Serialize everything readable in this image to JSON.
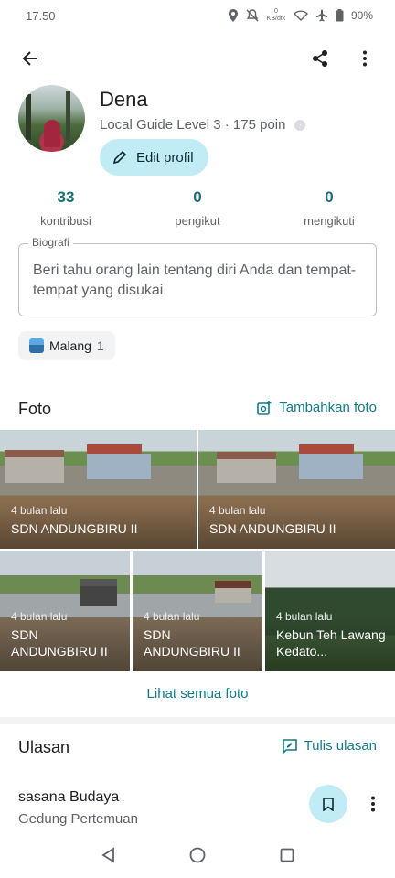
{
  "status_bar": {
    "time": "17.50",
    "speed": "0 KB/dtk",
    "battery": "90%"
  },
  "profile": {
    "name": "Dena",
    "level": "Local Guide Level 3 · 175 poin",
    "edit_label": "Edit profil"
  },
  "stats": [
    {
      "value": "33",
      "label": "kontribusi"
    },
    {
      "value": "0",
      "label": "pengikut"
    },
    {
      "value": "0",
      "label": "mengikuti"
    }
  ],
  "bio": {
    "label": "Biografi",
    "placeholder": "Beri tahu orang lain tentang diri Anda dan tempat-tempat yang disukai"
  },
  "chip": {
    "label": "Malang",
    "count": "1"
  },
  "photos_section": {
    "title": "Foto",
    "add_label": "Tambahkan foto",
    "items": [
      {
        "time": "4 bulan lalu",
        "title": "SDN ANDUNGBIRU II"
      },
      {
        "time": "4 bulan lalu",
        "title": "SDN ANDUNGBIRU II"
      },
      {
        "time": "4 bulan lalu",
        "title": "SDN ANDUNGBIRU II"
      },
      {
        "time": "4 bulan lalu",
        "title": "SDN ANDUNGBIRU II"
      },
      {
        "time": "4 bulan lalu",
        "title": "Kebun Teh Lawang Kedato..."
      }
    ],
    "see_all": "Lihat semua foto"
  },
  "reviews_section": {
    "title": "Ulasan",
    "write_label": "Tulis ulasan",
    "first": {
      "name": "sasana Budaya",
      "category": "Gedung Pertemuan"
    }
  },
  "colors": {
    "accent": "#137a87",
    "chip_bg": "#c2ecf5"
  },
  "icons": [
    "back-arrow-icon",
    "share-icon",
    "more-vert-icon",
    "pencil-icon",
    "add-photo-icon",
    "rate-review-icon",
    "bookmark-icon",
    "nav-back-icon",
    "nav-home-icon",
    "nav-recents-icon"
  ]
}
